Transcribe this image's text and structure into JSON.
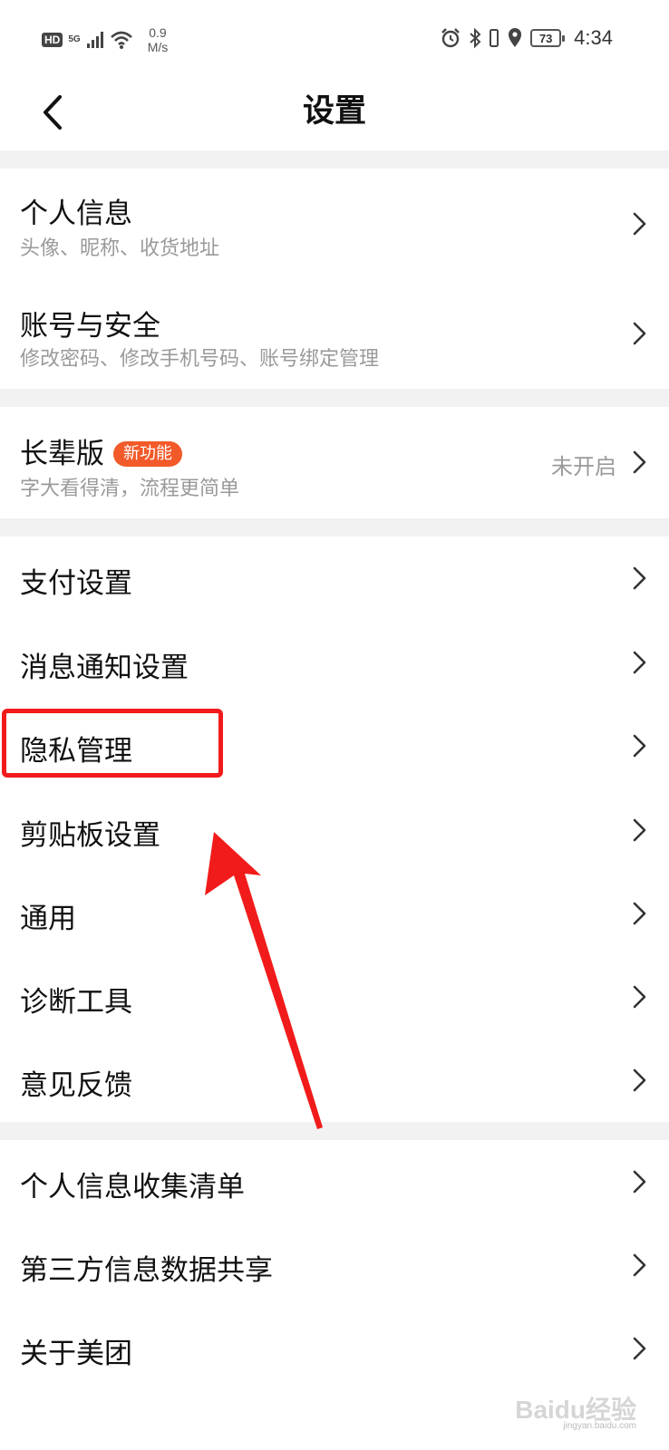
{
  "status_bar": {
    "hd": "HD",
    "network": "5G",
    "speed_value": "0.9",
    "speed_unit": "M/s",
    "battery": "73",
    "time": "4:34"
  },
  "nav": {
    "title": "设置",
    "back_icon": "chevron-left-icon"
  },
  "groups": [
    {
      "items": [
        {
          "title": "个人信息",
          "subtitle": "头像、昵称、收货地址"
        },
        {
          "title": "账号与安全",
          "subtitle": "修改密码、修改手机号码、账号绑定管理"
        }
      ]
    },
    {
      "items": [
        {
          "title": "长辈版",
          "badge": "新功能",
          "subtitle": "字大看得清，流程更简单",
          "status": "未开启"
        }
      ]
    },
    {
      "items": [
        {
          "title": "支付设置"
        },
        {
          "title": "消息通知设置"
        },
        {
          "title": "隐私管理"
        },
        {
          "title": "剪贴板设置"
        },
        {
          "title": "通用"
        },
        {
          "title": "诊断工具"
        },
        {
          "title": "意见反馈"
        }
      ]
    },
    {
      "items": [
        {
          "title": "个人信息收集清单"
        },
        {
          "title": "第三方信息数据共享"
        },
        {
          "title": "关于美团"
        }
      ]
    }
  ],
  "annotation": {
    "highlight_color": "#f21b1b",
    "arrow_color": "#f21b1b"
  },
  "watermark": {
    "brand": "Baidu经验",
    "site": "jingyan.baidu.com"
  },
  "colors": {
    "badge": "#f25a29",
    "separator": "#f2f2f2",
    "subtitle": "#9a9a9a"
  }
}
